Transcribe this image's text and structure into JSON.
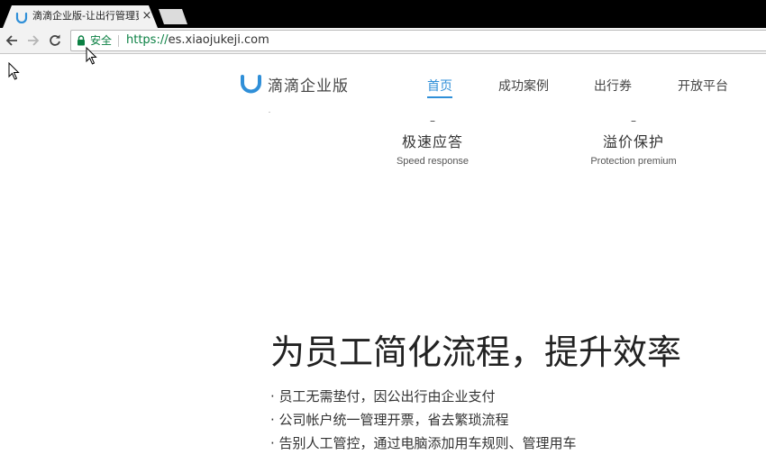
{
  "browser": {
    "tab": {
      "title": "滴滴企业版-让出行管理更",
      "close_glyph": "×"
    },
    "toolbar": {
      "secure_label": "安全",
      "url_scheme": "https://",
      "url_host": "es.xiaojukeji.com"
    }
  },
  "page": {
    "logo_text": "滴滴企业版",
    "nav": [
      {
        "label": "首页",
        "active": true
      },
      {
        "label": "成功案例",
        "active": false
      },
      {
        "label": "出行券",
        "active": false
      },
      {
        "label": "开放平台",
        "active": false
      }
    ],
    "features": [
      {
        "dash": "–",
        "title": "极速应答",
        "subtitle": "Speed response"
      },
      {
        "dash": "–",
        "title": "溢价保护",
        "subtitle": "Protection premium"
      }
    ],
    "headline": "为员工简化流程，提升效率",
    "bullets": [
      "· 员工无需垫付，因公出行由企业支付",
      "· 公司帐户统一管理开票，省去繁琐流程",
      "· 告别人工管控，通过电脑添加用车规则、管理用车"
    ]
  },
  "colors": {
    "brand_blue": "#2f8fd8",
    "secure_green": "#0b8043",
    "chrome_bg": "#f2f2f2",
    "tabstrip_bg": "#000000"
  },
  "icons": [
    "didi-favicon-icon",
    "close-icon",
    "back-arrow-icon",
    "forward-arrow-icon",
    "reload-icon",
    "lock-icon",
    "didi-logo-icon",
    "mouse-cursor-icon"
  ]
}
